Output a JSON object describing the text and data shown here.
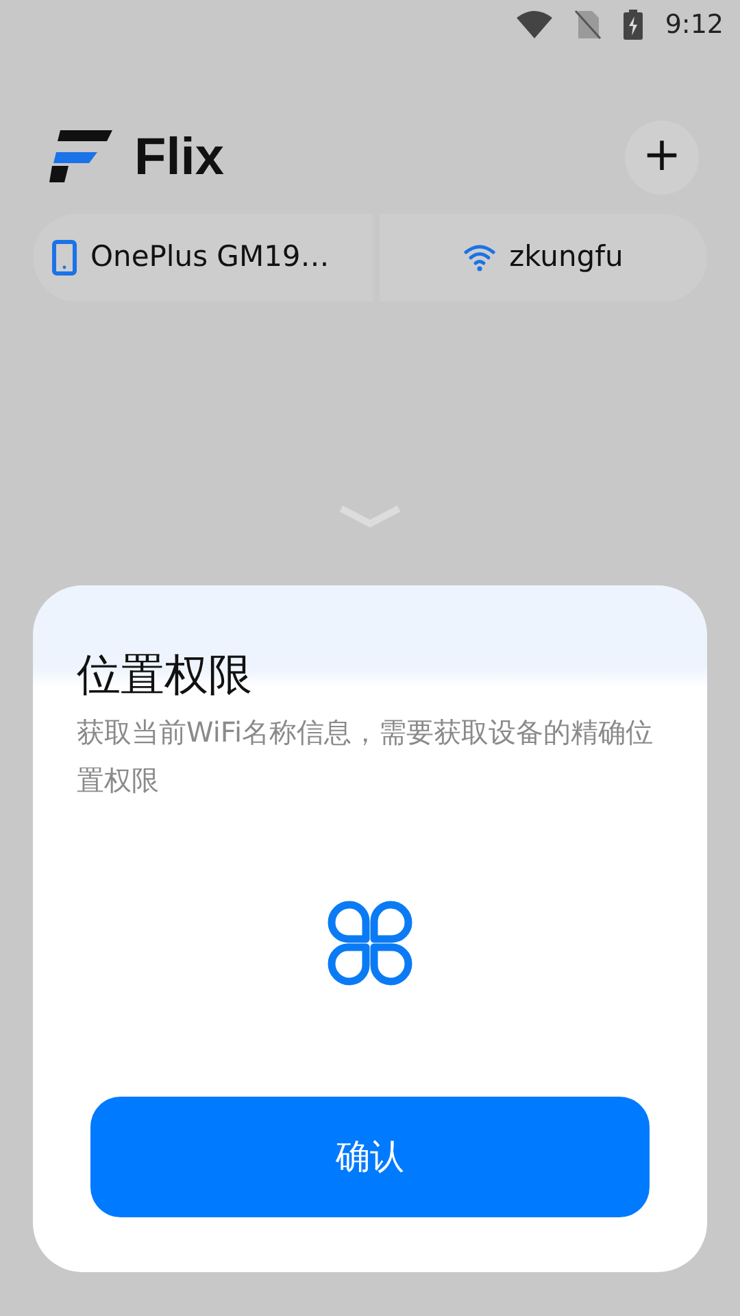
{
  "status_bar": {
    "time": "9:12"
  },
  "header": {
    "app_title": "Flix",
    "add_button": "+"
  },
  "chips": [
    {
      "kind": "device",
      "label": "OnePlus GM19…"
    },
    {
      "kind": "wifi",
      "label": "zkungfu"
    }
  ],
  "dialog": {
    "title": "位置权限",
    "description": "获取当前WiFi名称信息，需要获取设备的精确位置权限",
    "confirm_button": "确认"
  }
}
